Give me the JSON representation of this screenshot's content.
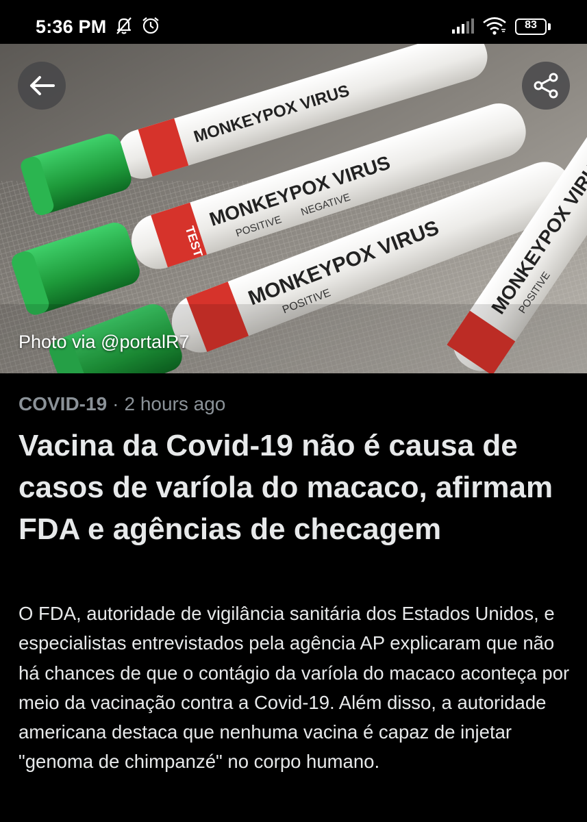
{
  "status_bar": {
    "time": "5:36 PM",
    "battery": "83",
    "icons": [
      "bell-off-icon",
      "alarm-icon",
      "signal-icon",
      "wifi-icon",
      "battery-icon"
    ]
  },
  "hero": {
    "photo_credit": "Photo via @portalR7",
    "back_icon": "arrow-left-icon",
    "share_icon": "share-icon",
    "tube_label_text": "MONKEYPOX VIRUS",
    "tube_tag_text": "TEST",
    "tube_option_positive": "POSITIVE",
    "tube_option_negative": "NEGATIVE",
    "cap_color": "#1e9a3a",
    "tag_color": "#d6332b"
  },
  "article": {
    "category": "COVID-19",
    "separator": "·",
    "time_ago": "2 hours ago",
    "headline": "Vacina da Covid-19 não é causa de casos de varíola do macaco, afirmam FDA e agências de checagem",
    "body": "O FDA, autoridade de vigilância sanitária dos Estados Unidos, e especialistas entrevistados pela agência AP explicaram que não há chances de que o contágio da varíola do macaco aconteça por meio da vacinação contra a Covid-19. Além disso, a autoridade americana destaca que nenhuma vacina é capaz de injetar \"genoma de chimpanzé\" no corpo humano."
  }
}
